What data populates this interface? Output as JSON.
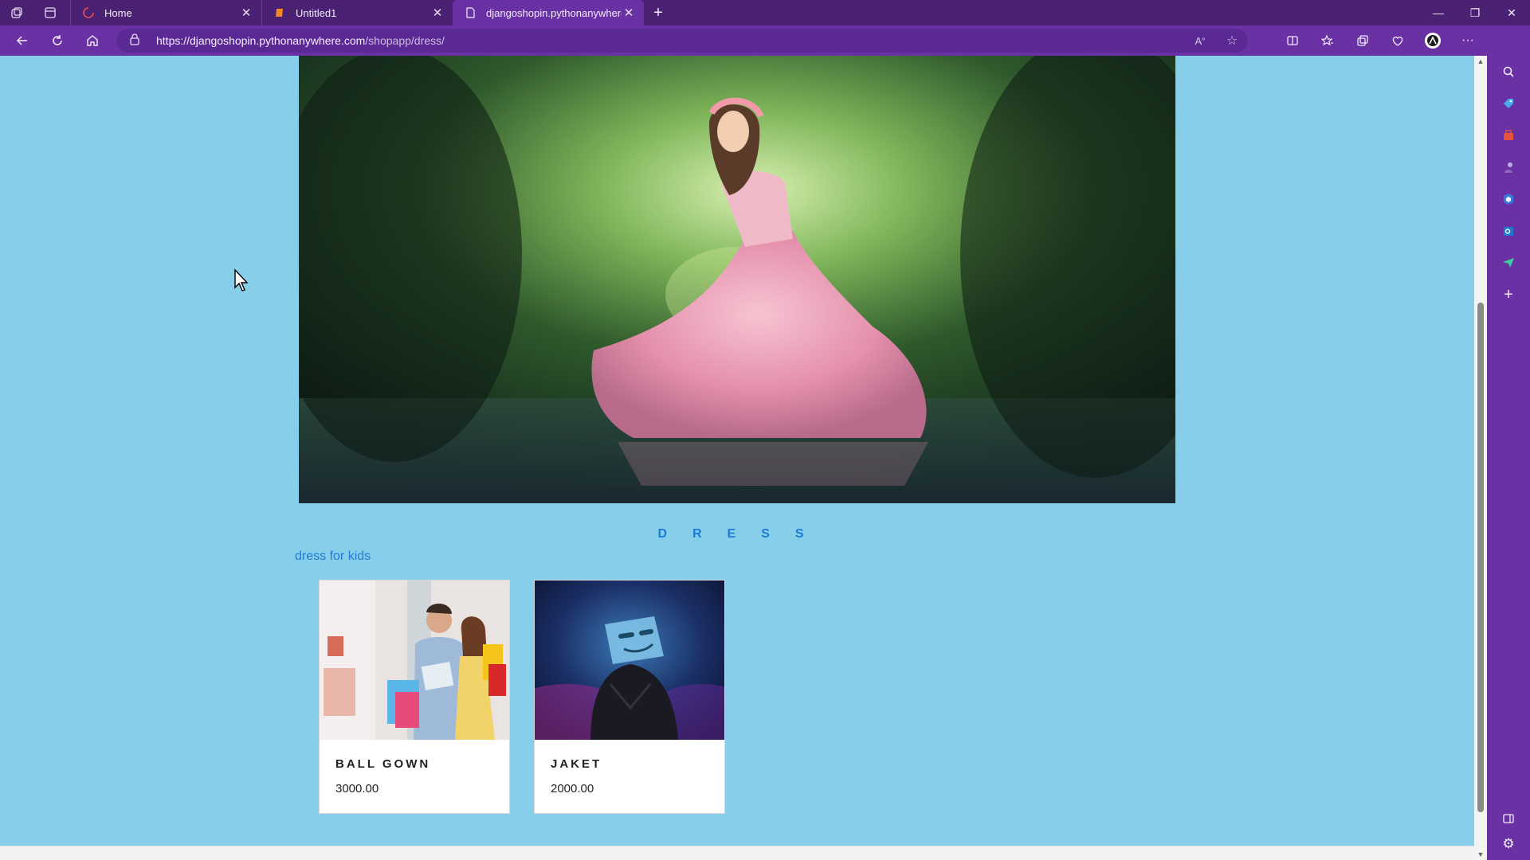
{
  "browser": {
    "tabs": [
      {
        "label": "Home",
        "icon": "loading-icon"
      },
      {
        "label": "Untitled1",
        "icon": "document-icon"
      },
      {
        "label": "djangoshopin.pythonanywhere.c",
        "icon": "page-icon"
      }
    ],
    "url_host": "https://djangoshopin.pythonanywhere.com",
    "url_path": "/shopapp/dress/",
    "accent": "#6a31a5",
    "titlebar_color": "#4b2173"
  },
  "page": {
    "heading": "DRESS",
    "subtitle": "dress for kids",
    "background": "#87ceeb",
    "products": [
      {
        "name": "BALL GOWN",
        "price": "3000.00",
        "image": "shopping-couple-image"
      },
      {
        "name": "JAKET",
        "price": "2000.00",
        "image": "marshmello-jacket-image"
      }
    ]
  }
}
